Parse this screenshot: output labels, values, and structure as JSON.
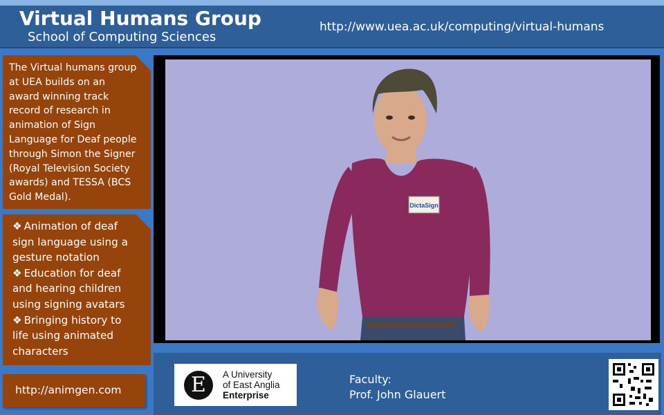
{
  "header": {
    "title": "Virtual Humans Group",
    "subtitle": "School of Computing Sciences",
    "url": "http://www.uea.ac.uk/computing/virtual-humans"
  },
  "intro": {
    "lines": [
      "The Virtual humans group",
      "at UEA builds on an",
      "award winning track",
      "record of research in",
      "animation of Sign",
      "Language for Deaf people",
      "through Simon the Signer",
      "(Royal Television Society",
      "awards) and TESSA (BCS",
      "Gold Medal)."
    ]
  },
  "bullets": {
    "glyph": "❖",
    "items": [
      {
        "line1": "Animation of deaf",
        "rest": [
          "sign language using a",
          "gesture notation"
        ]
      },
      {
        "line1": "Education for deaf",
        "rest": [
          "and hearing children",
          "using signing avatars"
        ]
      },
      {
        "line1": "Bringing history to",
        "rest": [
          "life using animated",
          "characters"
        ]
      }
    ]
  },
  "link": {
    "text": "http://animgen.com"
  },
  "video": {
    "badge_text": "DictaSign",
    "colors": {
      "background": "#adacdb",
      "shirt": "#8a2a5c",
      "skin": "#d9a98b",
      "hair": "#4e4a38"
    }
  },
  "logo": {
    "mark": "E",
    "line1": "A University",
    "line2": "of East Anglia",
    "line3": "Enterprise"
  },
  "faculty": {
    "label": "Faculty:",
    "name": "Prof. John Glauert"
  },
  "qr": {
    "icon": "qr-code-icon"
  }
}
